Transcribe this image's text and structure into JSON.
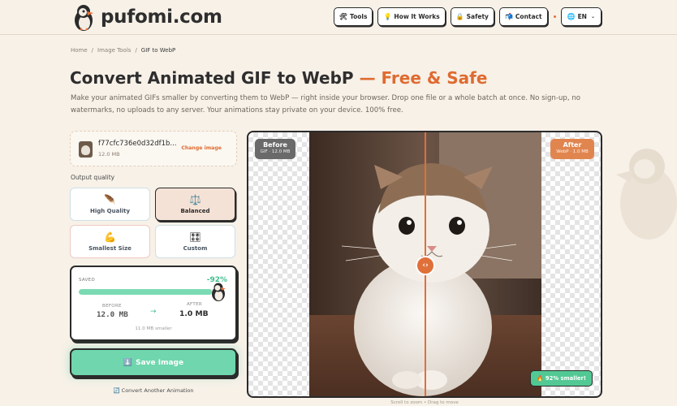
{
  "brand": {
    "name": "pufomi.com"
  },
  "nav": {
    "items": [
      {
        "icon": "tools-icon",
        "glyph": "🛠",
        "label": "Tools"
      },
      {
        "icon": "lightbulb-icon",
        "glyph": "💡",
        "label": "How It Works"
      },
      {
        "icon": "lock-icon",
        "glyph": "🔒",
        "label": "Safety"
      },
      {
        "icon": "mail-icon",
        "glyph": "📬",
        "label": "Contact"
      }
    ],
    "language": {
      "icon": "globe-icon",
      "glyph": "🌐",
      "label": "EN"
    }
  },
  "breadcrumb": [
    "Home",
    "Image Tools",
    "GIF to WebP"
  ],
  "page": {
    "title": "Convert Animated GIF to WebP",
    "title_accent": "— Free & Safe",
    "description": "Make your animated GIFs smaller by converting them to WebP — right inside your browser. Drop one file or a whole batch at once. No sign-up, no watermarks, no uploads to any server. Your animations stay private on your device. 100% free."
  },
  "file": {
    "name": "f77cfc736e0d32df1b...",
    "size": "12.0 MB",
    "change_label": "Change image"
  },
  "quality": {
    "label": "Output quality",
    "options": [
      {
        "icon": "feather-icon",
        "glyph": "🪶",
        "label": "High Quality",
        "active": false
      },
      {
        "icon": "balance-scale-icon",
        "glyph": "⚖️",
        "label": "Balanced",
        "active": true
      },
      {
        "icon": "flexed-bicep-icon",
        "glyph": "💪",
        "label": "Smallest Size",
        "active": false
      },
      {
        "icon": "dice-icon",
        "glyph": "🎛",
        "label": "Custom",
        "active": false
      }
    ]
  },
  "stats": {
    "saved_label": "SAVED",
    "saved_percent": "-92%",
    "saved_fraction": 0.92,
    "before_label": "BEFORE",
    "before_value": "12.0 MB",
    "after_label": "AFTER",
    "after_value": "1.0 MB",
    "arrow": "→",
    "smaller_text": "11.0 MB smaller"
  },
  "actions": {
    "save_icon": "⬇️",
    "save_label": "Save Image",
    "convert_icon": "🔄",
    "convert_label": "Convert Another Animation"
  },
  "preview": {
    "before_title": "Before",
    "before_sub": "GIF · 12.0 MB",
    "after_title": "After",
    "after_sub": "WebP · 1.0 MB",
    "handle_glyph": "‹›",
    "smaller_badge": "🔥 92% smaller!",
    "hint": "Scroll to zoom • Drag to move"
  },
  "colors": {
    "accent": "#df6b30",
    "success": "#6fd6ad",
    "background": "#f7f1e8"
  }
}
